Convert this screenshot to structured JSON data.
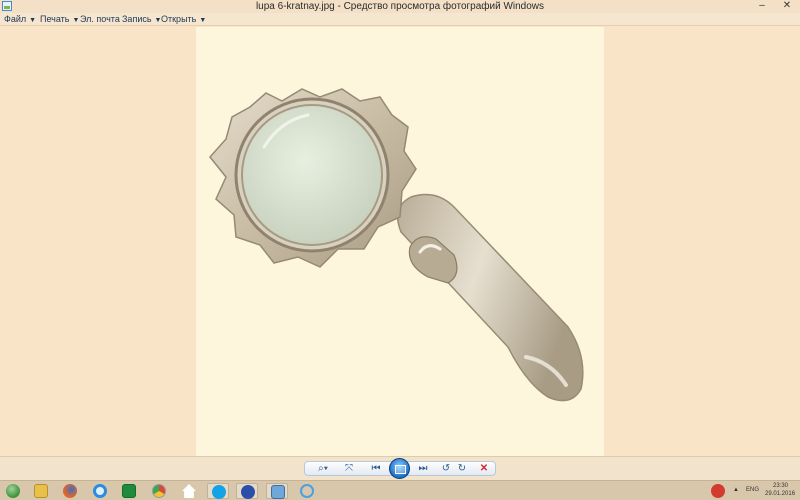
{
  "window": {
    "title": "lupa 6-kratnay.jpg - Средство просмотра фотографий Windows",
    "minimize_glyph": "–",
    "close_glyph": "✕"
  },
  "menu": {
    "items": [
      {
        "label": "Файл",
        "has_dropdown": true
      },
      {
        "label": "Печать",
        "has_dropdown": true
      },
      {
        "label": "Эл. почта",
        "has_dropdown": false
      },
      {
        "label": "Запись",
        "has_dropdown": true
      },
      {
        "label": "Открыть",
        "has_dropdown": true
      }
    ],
    "caret": "▼"
  },
  "photo": {
    "subject_icon": "magnifying-glass",
    "background_color": "#fdf6dc"
  },
  "controls": {
    "zoom_glyph": "⌕▾",
    "fit_glyph": "⤧",
    "prev_glyph": "⏮",
    "next_glyph": "⏭",
    "rotate_ccw_glyph": "↺",
    "rotate_cw_glyph": "↻",
    "delete_glyph": "✕",
    "delete_color": "#d0262b"
  },
  "taskbar": {
    "apps": [
      {
        "name": "start-orb-icon",
        "color": "#3d8f3a"
      },
      {
        "name": "file-explorer-icon",
        "color": "#e8c04a"
      },
      {
        "name": "firefox-icon",
        "color": "#e0662a"
      },
      {
        "name": "ie-icon",
        "color": "#2f8be0"
      },
      {
        "name": "excel-icon",
        "color": "#1f8a3c"
      },
      {
        "name": "chrome-icon",
        "color": "#d94a38"
      },
      {
        "name": "home-icon",
        "color": "#ffffff"
      },
      {
        "name": "skype-icon",
        "color": "#14a3e6"
      },
      {
        "name": "sailboat-icon",
        "color": "#2b4fa8"
      },
      {
        "name": "photo-viewer-icon",
        "color": "#6fa7d8"
      },
      {
        "name": "app-m-icon",
        "color": "#4aa0e0"
      }
    ],
    "language": "ENG",
    "time": "23:30",
    "date": "29.01.2016"
  }
}
